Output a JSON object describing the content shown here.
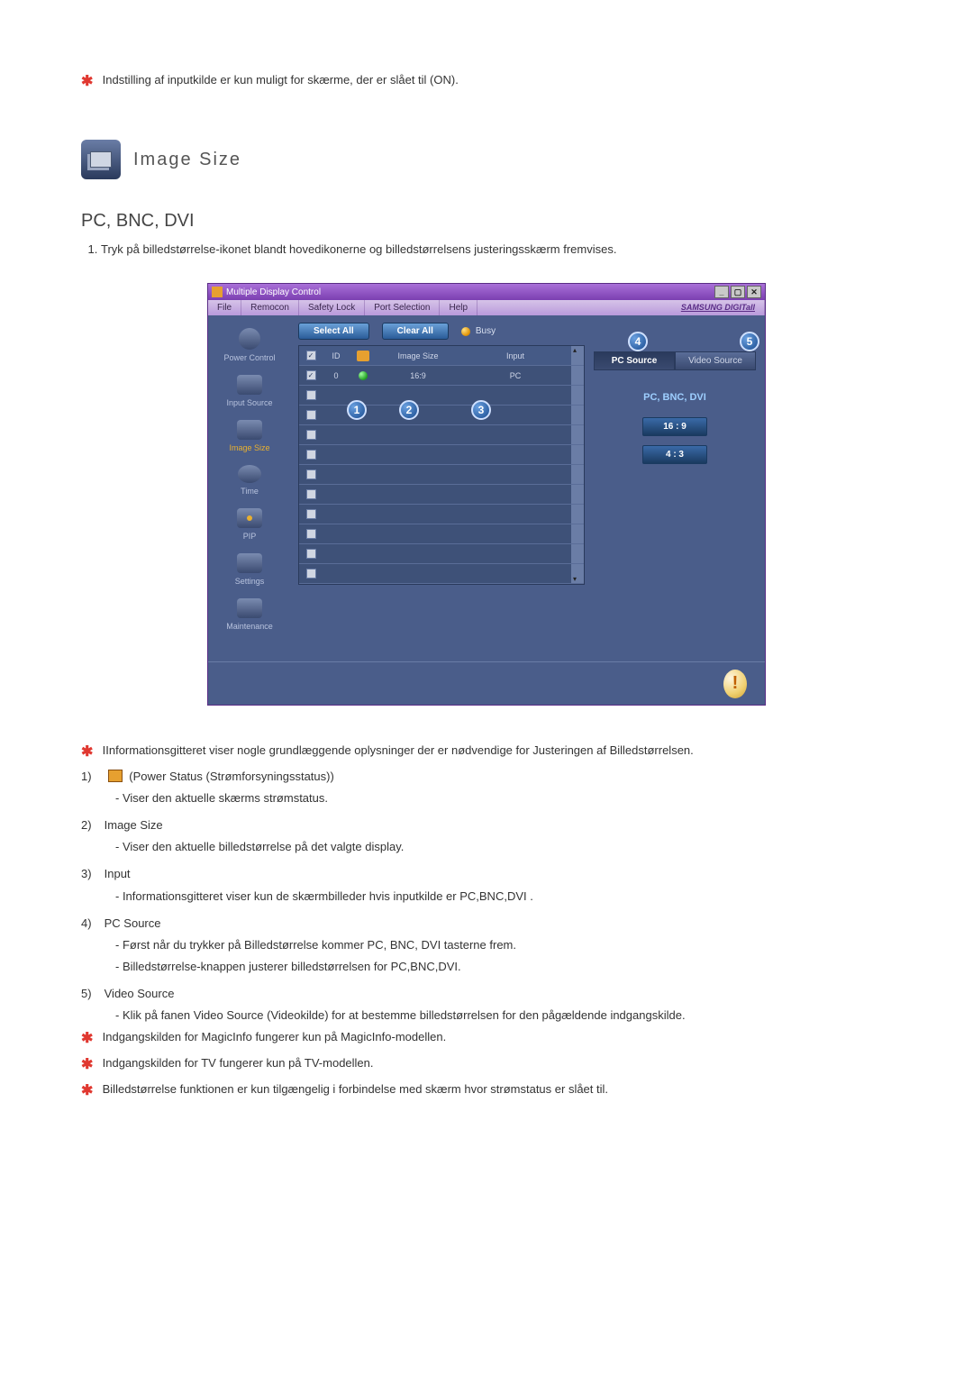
{
  "top_note": "Indstilling af inputkilde er kun muligt for skærme, der er slået til (ON).",
  "section_title": "Image Size",
  "subheading": "PC, BNC, DVI",
  "numbered_intro": "Tryk på billedstørrelse-ikonet blandt hovedikonerne og billedstørrelsens justeringsskærm fremvises.",
  "app": {
    "title": "Multiple Display Control",
    "menu": {
      "file": "File",
      "remocon": "Remocon",
      "safety": "Safety Lock",
      "port": "Port Selection",
      "help": "Help"
    },
    "brand": "SAMSUNG DIGITall",
    "sidebar": {
      "power": "Power Control",
      "input": "Input Source",
      "image_size": "Image Size",
      "time": "Time",
      "pip": "PIP",
      "settings": "Settings",
      "maintenance": "Maintenance"
    },
    "toolbar": {
      "select_all": "Select All",
      "clear_all": "Clear All",
      "busy": "Busy"
    },
    "grid": {
      "hdr_id": "ID",
      "hdr_image_size": "Image Size",
      "hdr_input": "Input",
      "row0_id": "0",
      "row0_image_size": "16:9",
      "row0_input": "PC"
    },
    "callouts": {
      "c1": "1",
      "c2": "2",
      "c3": "3",
      "c4": "4",
      "c5": "5"
    },
    "tabs": {
      "pc": "PC Source",
      "video": "Video Source"
    },
    "src_label": "PC, BNC, DVI",
    "ratio_169": "16 : 9",
    "ratio_43": "4 : 3",
    "foot_glyph": "!"
  },
  "info_star": "IInformationsgitteret viser nogle grundlæggende oplysninger der er nødvendige for Justeringen af Billedstørrelsen.",
  "list": {
    "n1": "1)",
    "i1_label": "(Power Status (Strømforsyningsstatus))",
    "i1_a": "- Viser den aktuelle skærms strømstatus.",
    "n2": "2)",
    "i2_title": "Image Size",
    "i2_a": "- Viser den aktuelle billedstørrelse på det valgte display.",
    "n3": "3)",
    "i3_title": "Input",
    "i3_a": "- Informationsgitteret viser kun de skærmbilleder hvis inputkilde er PC,BNC,DVI .",
    "n4": "4)",
    "i4_title": "PC Source",
    "i4_a": "- Først når du trykker på Billedstørrelse kommer PC, BNC, DVI tasterne frem.",
    "i4_b": "- Billedstørrelse-knappen justerer billedstørrelsen for PC,BNC,DVI.",
    "n5": "5)",
    "i5_title": "Video Source",
    "i5_a": "- Klik på fanen Video Source (Videokilde) for at bestemme billedstørrelsen for den pågældende indgangskilde."
  },
  "notes": {
    "a": "Indgangskilden for MagicInfo fungerer kun på MagicInfo-modellen.",
    "b": "Indgangskilden for TV fungerer kun på TV-modellen.",
    "c": "Billedstørrelse funktionen er kun tilgængelig i forbindelse med skærm hvor strømstatus er slået til."
  }
}
